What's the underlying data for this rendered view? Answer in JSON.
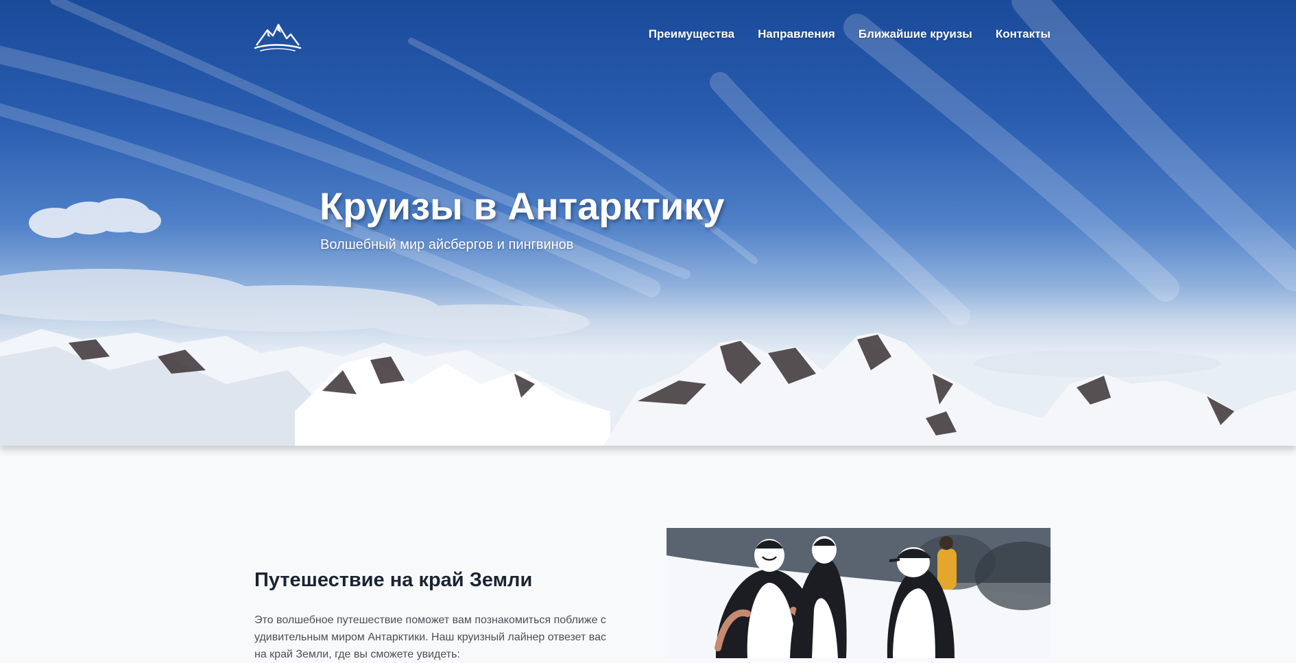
{
  "header": {
    "logo_icon": "mountains-logo-icon",
    "nav": [
      {
        "label": "Преимущества"
      },
      {
        "label": "Направления"
      },
      {
        "label": "Ближайшие круизы"
      },
      {
        "label": "Контакты"
      }
    ]
  },
  "hero": {
    "title": "Круизы в Антарктику",
    "subtitle": "Волшебный мир айсбергов и пингвинов",
    "background": "antarctic-mountains-photo"
  },
  "about": {
    "title": "Путешествие на край Земли",
    "text": "Это волшебное путешествие поможет вам познакомиться поближе с удивительным миром Антарктики. Наш круизный лайнер отвезет вас на край Земли, где вы сможете увидеть:",
    "image": "penguins-photo"
  },
  "colors": {
    "sky": "#2a5eb0",
    "page_bg": "#f8f9fb",
    "heading": "#1b2433",
    "body_text": "#4a4f57"
  }
}
